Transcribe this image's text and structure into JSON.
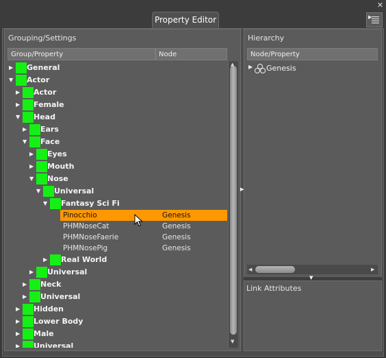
{
  "window": {
    "tab_title": "Property Editor",
    "close_glyph": "✕"
  },
  "grouping": {
    "title": "Grouping/Settings",
    "columns": [
      "Group/Property",
      "Node"
    ],
    "tree": [
      {
        "label": "General",
        "expanded": false
      },
      {
        "label": "Actor",
        "expanded": true
      },
      {
        "label": "Actor",
        "expanded": false
      },
      {
        "label": "Female",
        "expanded": false
      },
      {
        "label": "Head",
        "expanded": true
      },
      {
        "label": "Ears",
        "expanded": false
      },
      {
        "label": "Face",
        "expanded": true
      },
      {
        "label": "Eyes",
        "expanded": false
      },
      {
        "label": "Mouth",
        "expanded": false
      },
      {
        "label": "Nose",
        "expanded": true
      },
      {
        "label": "Universal",
        "expanded": true
      },
      {
        "label": "Fantasy Sci Fi",
        "expanded": true
      },
      {
        "label": "Real World",
        "expanded": false
      },
      {
        "label": "Universal",
        "expanded": false
      },
      {
        "label": "Neck",
        "expanded": false
      },
      {
        "label": "Universal",
        "expanded": false
      },
      {
        "label": "Hidden",
        "expanded": false
      },
      {
        "label": "Lower Body",
        "expanded": false
      },
      {
        "label": "Male",
        "expanded": false
      },
      {
        "label": "Universal",
        "expanded": false
      }
    ],
    "properties": [
      {
        "name": "Pinocchio",
        "node": "Genesis",
        "selected": true
      },
      {
        "name": "PHMNoseCat",
        "node": "Genesis",
        "selected": false
      },
      {
        "name": "PHMNoseFaerie",
        "node": "Genesis",
        "selected": false
      },
      {
        "name": "PHMNosePig",
        "node": "Genesis",
        "selected": false
      }
    ]
  },
  "hierarchy": {
    "title": "Hierarchy",
    "column": "Node/Property",
    "items": [
      {
        "label": "Genesis",
        "icon": "figure-icon"
      }
    ]
  },
  "link_attributes": {
    "title": "Link Attributes"
  },
  "colors": {
    "selection": "#ff9800",
    "group_square": "#14f014"
  }
}
